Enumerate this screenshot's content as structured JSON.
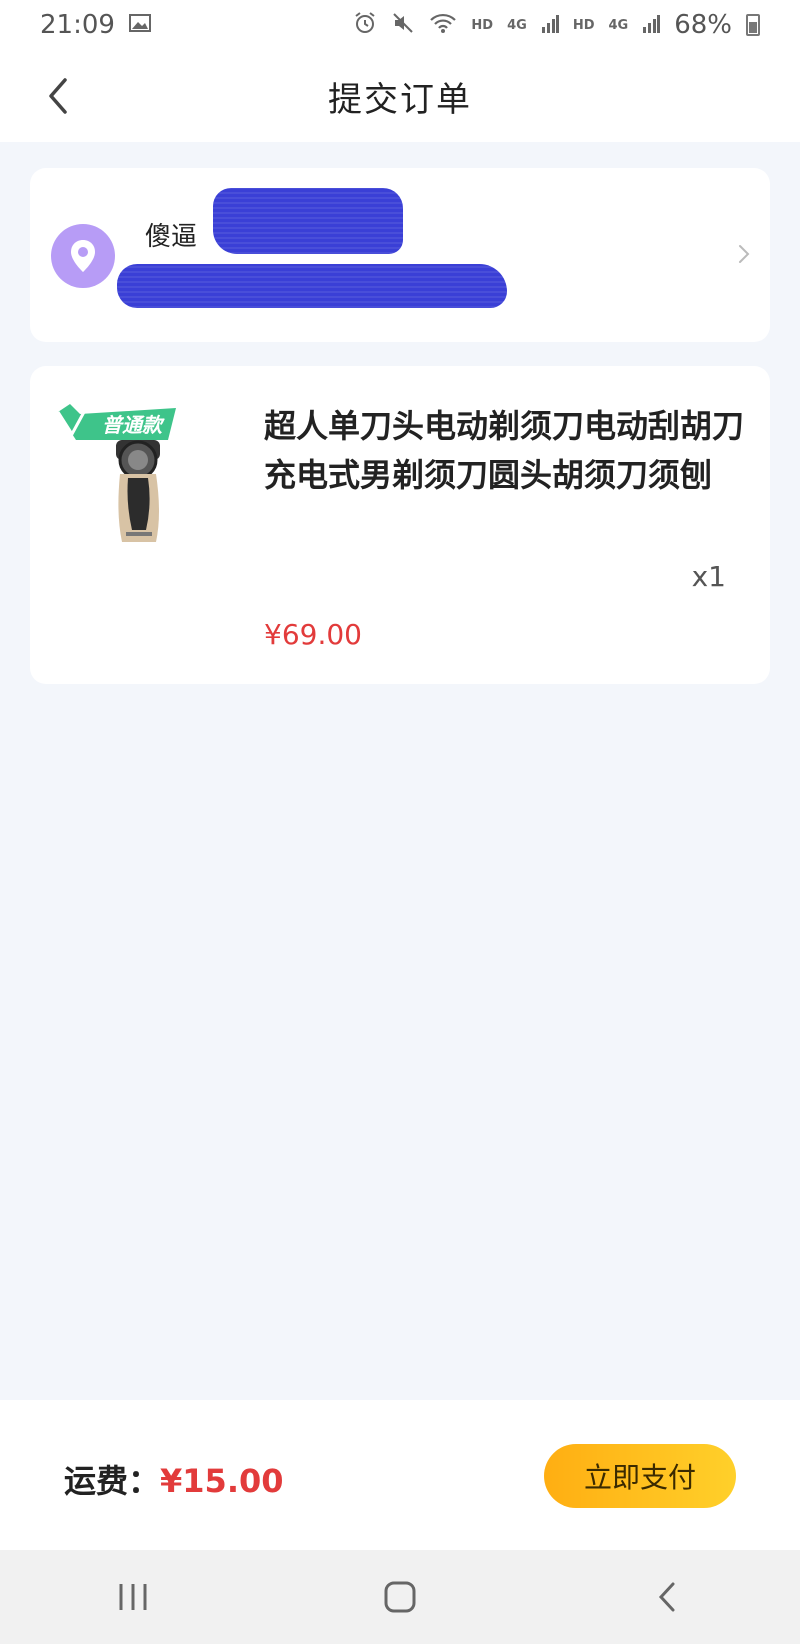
{
  "status": {
    "time": "21:09",
    "network1": "HD",
    "network1_sig": "4G",
    "network2": "HD",
    "network2_sig": "4G",
    "battery": "68%"
  },
  "header": {
    "title": "提交订单"
  },
  "address": {
    "name": "傻逼"
  },
  "product": {
    "title": "超人单刀头电动剃须刀电动刮胡刀充电式男剃须刀圆头胡须刀须刨",
    "badge": "普通款",
    "quantity": "x1",
    "price": "¥69.00"
  },
  "footer": {
    "shipping_label": "运费：",
    "shipping_amount": "¥15.00",
    "pay_label": "立即支付"
  },
  "colors": {
    "price": "#e23b3b",
    "pay_button": "#ffbf1c",
    "location_pin": "#b79cf6",
    "page_background": "#f3f6fb"
  }
}
